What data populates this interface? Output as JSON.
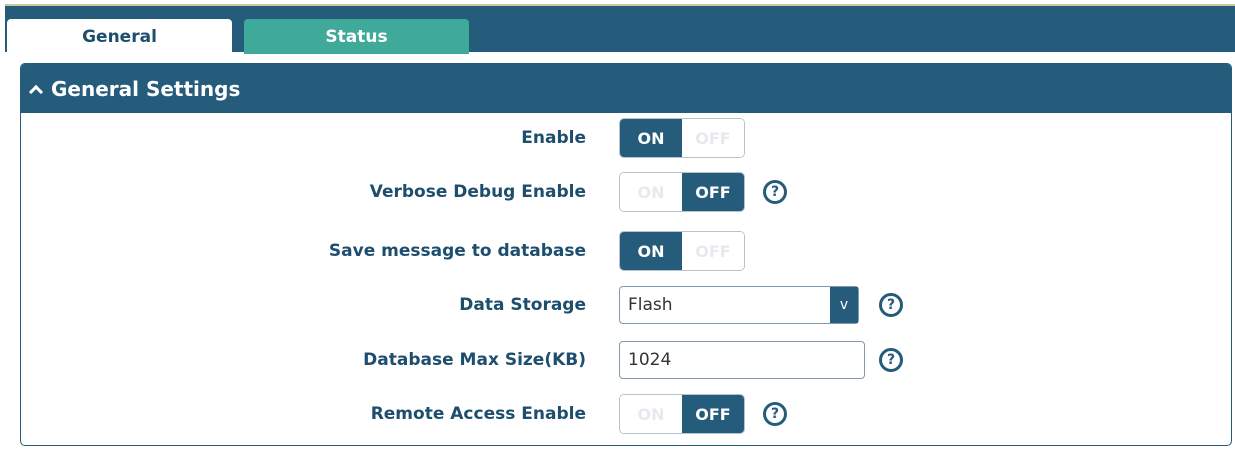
{
  "tabs": [
    {
      "label": "General"
    },
    {
      "label": "Status"
    }
  ],
  "panel": {
    "title": "General Settings"
  },
  "rows": {
    "enable": {
      "label": "Enable",
      "on": "ON",
      "off": "OFF"
    },
    "verbose": {
      "label": "Verbose Debug Enable",
      "on": "ON",
      "off": "OFF"
    },
    "save_db": {
      "label": "Save message to database",
      "on": "ON",
      "off": "OFF"
    },
    "storage": {
      "label": "Data Storage",
      "value": "Flash",
      "arrow": "v"
    },
    "max_size": {
      "label": "Database Max Size(KB)",
      "value": "1024"
    },
    "remote": {
      "label": "Remote Access Enable",
      "on": "ON",
      "off": "OFF"
    }
  },
  "help_glyph": "?"
}
